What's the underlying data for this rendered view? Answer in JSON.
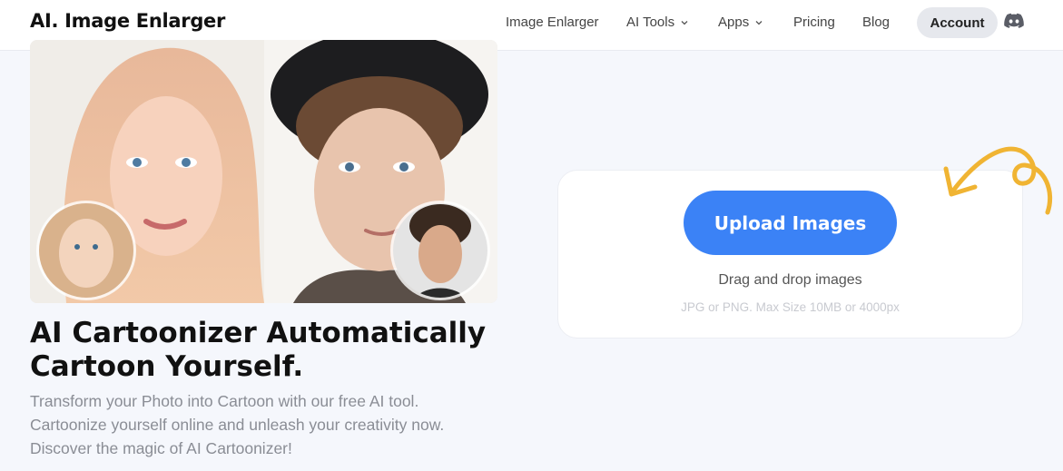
{
  "header": {
    "logo": "AI. Image Enlarger",
    "nav": [
      {
        "label": "Image Enlarger",
        "dropdown": false
      },
      {
        "label": "AI Tools",
        "dropdown": true
      },
      {
        "label": "Apps",
        "dropdown": true
      },
      {
        "label": "Pricing",
        "dropdown": false
      },
      {
        "label": "Blog",
        "dropdown": false
      }
    ],
    "account_label": "Account",
    "discord_icon": "discord-icon"
  },
  "hero": {
    "title": "AI Cartoonizer Automatically Cartoon Yourself.",
    "subtitle": "Transform your Photo into Cartoon with our free AI tool. Cartoonize yourself online and unleash your creativity now. Discover the magic of AI Cartoonizer!"
  },
  "upload": {
    "button_label": "Upload Images",
    "drag_text": "Drag and drop images",
    "formats_text": "JPG or PNG. Max Size 10MB or 4000px"
  },
  "colors": {
    "accent": "#3b82f6",
    "arrow": "#f0b433",
    "background": "#f5f7fc"
  }
}
